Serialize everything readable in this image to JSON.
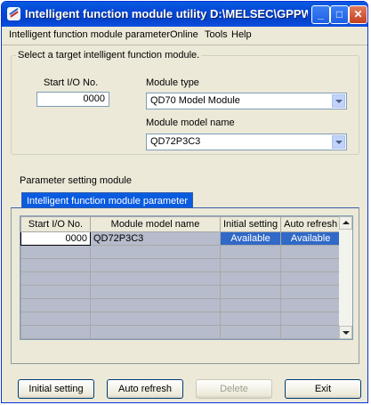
{
  "window": {
    "title": "Intelligent function module utility D:\\MELSEC\\GPPW\\PT..."
  },
  "menu": [
    {
      "label": "Intelligent function module parameter"
    },
    {
      "label": "Online"
    },
    {
      "label": "Tools"
    },
    {
      "label": "Help"
    }
  ],
  "target": {
    "legend": "Select a target intelligent function module.",
    "start_io_label": "Start I/O No.",
    "start_io_value": "0000",
    "module_type_label": "Module type",
    "module_type_value": "QD70 Model Module",
    "module_name_label": "Module model name",
    "module_name_value": "QD72P3C3"
  },
  "param": {
    "section_label": "Parameter setting module",
    "tab_label": "Intelligent function module parameter",
    "columns": [
      "Start I/O No.",
      "Module model name",
      "Initial setting",
      "Auto refresh"
    ],
    "rows": [
      {
        "start_io": "0000",
        "model": "QD72P3C3",
        "initial": "Available",
        "auto": "Available"
      }
    ]
  },
  "buttons": {
    "initial_setting": "Initial setting",
    "auto_refresh": "Auto refresh",
    "delete": "Delete",
    "exit": "Exit"
  }
}
